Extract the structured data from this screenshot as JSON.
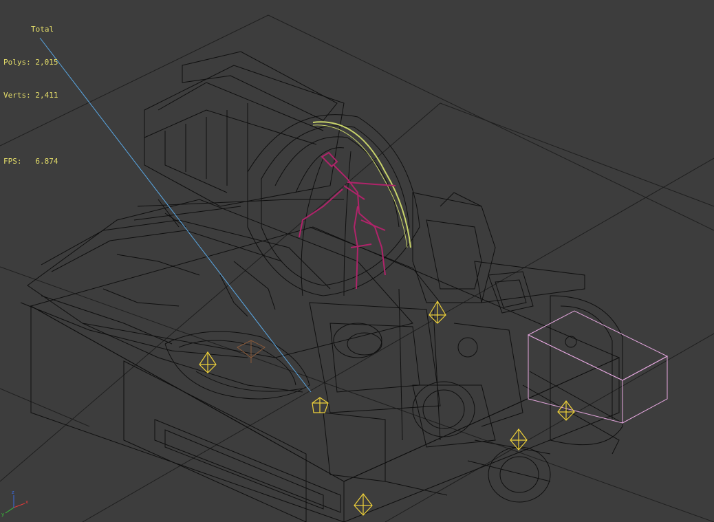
{
  "viewport": {
    "stats": {
      "total_label": "Total",
      "polys_label": "Polys:",
      "polys_value": "2,015",
      "verts_label": "Verts:",
      "verts_value": "2,411",
      "fps_label": "FPS:",
      "fps_value": "6.874"
    },
    "axis_gizmo": {
      "x_label": "x",
      "y_label": "y",
      "z_label": "z"
    }
  },
  "colors": {
    "background": "#3d3d3d",
    "grid": "#1f1f1f",
    "wireframe": "#0f0f0f",
    "stats_text": "#e6df6a",
    "camera_line": "#5aa9e6",
    "helper_yellow": "#f0d23a",
    "arc_yellow": "#c9d46a",
    "bone_magenta": "#b0246a",
    "box_pink": "#e6a8e0",
    "dummy_orange": "#8a5a3a"
  }
}
